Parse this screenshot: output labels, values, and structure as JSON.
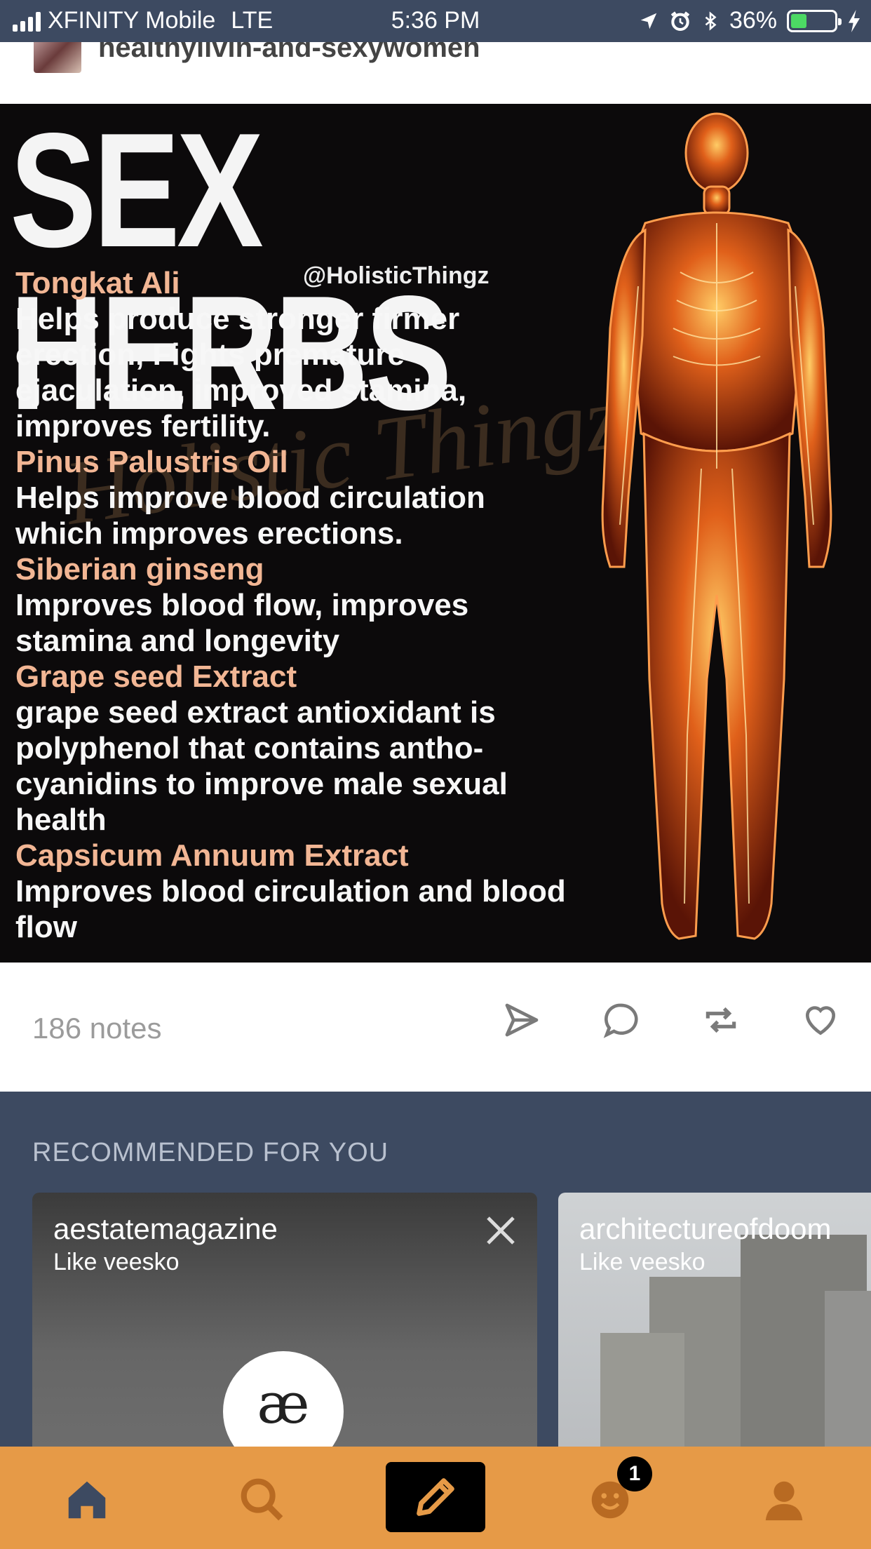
{
  "status_bar": {
    "carrier": "XFINITY Mobile",
    "network": "LTE",
    "time": "5:36 PM",
    "battery_percent": "36%",
    "battery_level": 0.36,
    "battery_color": "#4cd964",
    "icons": [
      "location-arrow-icon",
      "alarm-icon",
      "bluetooth-icon",
      "charging-bolt-icon"
    ]
  },
  "post": {
    "blog_name": "healthylivin-and-sexywomen",
    "image": {
      "headline": "SEX HERBS",
      "handle": "@HolisticThingz",
      "watermark": "Holistic Thingz",
      "herbs": [
        {
          "name": "Tongkat Ali",
          "desc": "Helps produce stronger firmer erection, Fights premature ejaculation, improved stamina, improves fertility."
        },
        {
          "name": "Pinus Palustris Oil",
          "desc": "Helps improve blood circulation which improves erections."
        },
        {
          "name": "Siberian ginseng",
          "desc": "Improves blood flow, improves stamina and longevity"
        },
        {
          "name": "Grape seed Extract",
          "desc": "grape seed extract antioxidant is polyphenol that contains antho-cyanidins to improve male sexual health"
        },
        {
          "name": "Capsicum Annuum Extract",
          "desc": "Improves blood circulation and blood flow"
        }
      ]
    },
    "notes": "186 notes",
    "actions": [
      "share-icon",
      "reply-icon",
      "reblog-icon",
      "like-icon"
    ]
  },
  "recommended": {
    "heading": "RECOMMENDED FOR YOU",
    "cards": [
      {
        "title": "aestatemagazine",
        "subtitle": "Like veesko",
        "logo": "æ"
      },
      {
        "title": "architectureofdoom",
        "subtitle": "Like veesko"
      }
    ]
  },
  "tab_bar": {
    "accent": "#e69a47",
    "tabs": [
      "home-icon",
      "search-icon",
      "compose-icon",
      "activity-icon",
      "account-icon"
    ],
    "activity_badge": "1"
  }
}
